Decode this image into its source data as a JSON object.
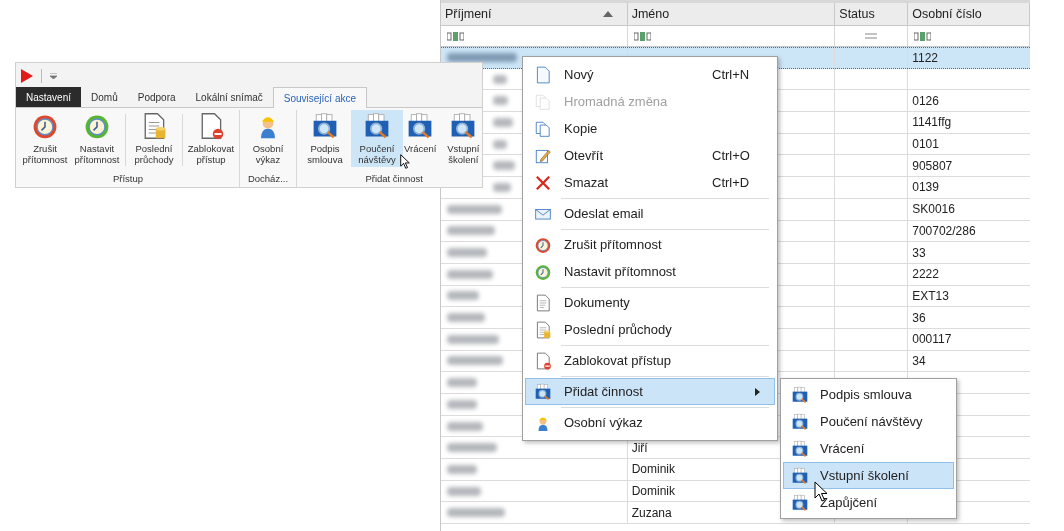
{
  "ribbon": {
    "quick_access": [
      {
        "kind": "play"
      },
      {
        "kind": "dropdown"
      }
    ],
    "tabs": [
      {
        "label": "Nastavení",
        "kind": "file",
        "selected": false
      },
      {
        "label": "Domů",
        "kind": "tab",
        "selected": false
      },
      {
        "label": "Podpora",
        "kind": "tab",
        "selected": false
      },
      {
        "label": "Lokální snímač",
        "kind": "tab",
        "selected": false
      },
      {
        "label": "Související akce",
        "kind": "tab",
        "selected": true
      }
    ],
    "groups": [
      {
        "label": "Přístup",
        "buttons": [
          {
            "kind": "clock-red",
            "label": "Zrušit přítomnost",
            "hovered": false
          },
          {
            "kind": "clock-green",
            "label": "Nastavit přítomnost",
            "hovered": false
          },
          {
            "kind": "separator"
          },
          {
            "kind": "doc-db",
            "label": "Poslední průchody",
            "hovered": false
          },
          {
            "kind": "separator"
          },
          {
            "kind": "doc-block",
            "label": "Zablokovat přístup",
            "hovered": false
          }
        ]
      },
      {
        "label": "Docház...",
        "buttons": [
          {
            "kind": "worker",
            "label": "Osobní výkaz",
            "hovered": false
          }
        ]
      },
      {
        "label": "Přidat činnost",
        "buttons": [
          {
            "kind": "activity",
            "label": "Podpis smlouva",
            "hovered": false
          },
          {
            "kind": "activity",
            "label": "Poučení návštěvy",
            "hovered": true
          },
          {
            "kind": "activity",
            "label": "Vrácení",
            "hovered": false
          },
          {
            "kind": "activity",
            "label": "Vstupní školení",
            "hovered": false
          }
        ]
      }
    ]
  },
  "grid": {
    "columns": [
      {
        "label": "Příjmení",
        "kind": "text",
        "sorted": true
      },
      {
        "label": "Jméno",
        "kind": "text",
        "sorted": false
      },
      {
        "label": "Status",
        "kind": "equals",
        "sorted": false
      },
      {
        "label": "Osobní číslo",
        "kind": "text",
        "sorted": false
      }
    ],
    "rows": [
      {
        "osobni_cislo": "1122",
        "selected": true
      },
      {
        "selected": false
      },
      {
        "osobni_cislo": "0126",
        "selected": false
      },
      {
        "osobni_cislo": "1141ffg",
        "selected": false
      },
      {
        "osobni_cislo": "0101",
        "selected": false
      },
      {
        "osobni_cislo": "905807",
        "selected": false
      },
      {
        "osobni_cislo": "0139",
        "selected": false
      },
      {
        "osobni_cislo": "SK0016",
        "selected": false
      },
      {
        "osobni_cislo": "700702/286",
        "selected": false
      },
      {
        "osobni_cislo": "33",
        "selected": false
      },
      {
        "osobni_cislo": "2222",
        "selected": false
      },
      {
        "osobni_cislo": "EXT13",
        "selected": false
      },
      {
        "osobni_cislo": "36",
        "selected": false
      },
      {
        "osobni_cislo": "000117",
        "selected": false
      },
      {
        "osobni_cislo": "34",
        "selected": false
      },
      {
        "selected": false
      },
      {
        "selected": false
      },
      {
        "selected": false
      },
      {
        "jmeno": "Jiří",
        "selected": false
      },
      {
        "jmeno": "Dominik",
        "selected": false
      },
      {
        "jmeno": "Dominik",
        "selected": false
      },
      {
        "jmeno": "Zuzana",
        "selected": false
      }
    ]
  },
  "context_menu": {
    "items": [
      {
        "kind": "new",
        "label": "Nový",
        "shortcut": "Ctrl+N",
        "disabled": false,
        "selected": false
      },
      {
        "kind": "batch",
        "label": "Hromadná změna",
        "disabled": true,
        "selected": false
      },
      {
        "kind": "copy",
        "label": "Kopie",
        "disabled": false,
        "selected": false
      },
      {
        "kind": "edit",
        "label": "Otevřít",
        "shortcut": "Ctrl+O",
        "disabled": false,
        "selected": false
      },
      {
        "kind": "delete",
        "label": "Smazat",
        "shortcut": "Ctrl+D",
        "disabled": false,
        "selected": false
      },
      {
        "kind": "separator"
      },
      {
        "kind": "mail",
        "label": "Odeslat email",
        "disabled": false,
        "selected": false
      },
      {
        "kind": "separator"
      },
      {
        "kind": "clock-red",
        "label": "Zrušit přítomnost",
        "disabled": false,
        "selected": false
      },
      {
        "kind": "clock-green",
        "label": "Nastavit přítomnost",
        "disabled": false,
        "selected": false
      },
      {
        "kind": "separator"
      },
      {
        "kind": "doc",
        "label": "Dokumenty",
        "disabled": false,
        "selected": false
      },
      {
        "kind": "doc-db",
        "label": "Poslední průchody",
        "disabled": false,
        "selected": false
      },
      {
        "kind": "separator"
      },
      {
        "kind": "doc-block",
        "label": "Zablokovat přístup",
        "disabled": false,
        "selected": false
      },
      {
        "kind": "separator"
      },
      {
        "kind": "activity-submenu",
        "label": "Přidat činnost",
        "disabled": false,
        "selected": true
      },
      {
        "kind": "separator"
      },
      {
        "kind": "worker",
        "label": "Osobní výkaz",
        "disabled": false,
        "selected": false
      }
    ]
  },
  "submenu": {
    "items": [
      {
        "label": "Podpis smlouva",
        "selected": false
      },
      {
        "label": "Poučení návštěvy",
        "selected": false
      },
      {
        "label": "Vrácení",
        "selected": false
      },
      {
        "label": "Vstupní školení",
        "selected": true
      },
      {
        "label": "Zapůjčení",
        "selected": false
      }
    ]
  }
}
